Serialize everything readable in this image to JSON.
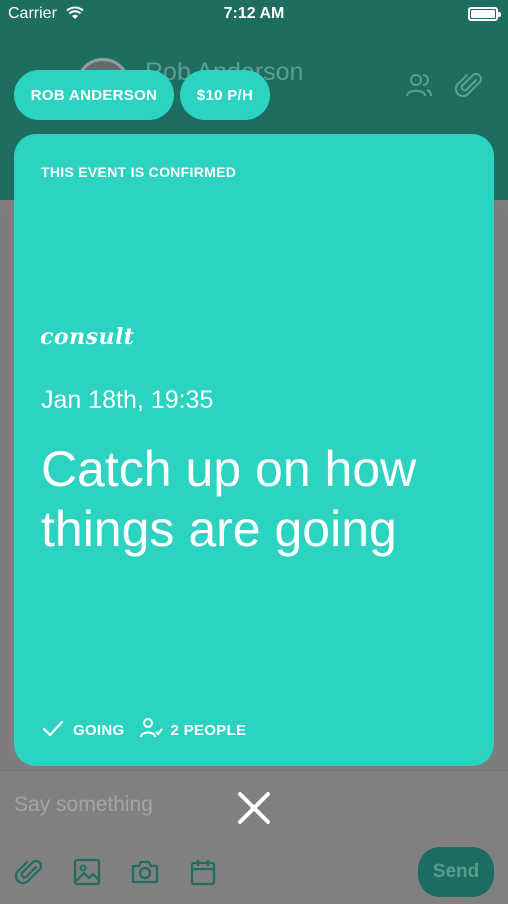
{
  "status_bar": {
    "carrier": "Carrier",
    "time": "7:12 AM"
  },
  "header": {
    "contact_name": "Rob Anderson"
  },
  "pills": {
    "name": "ROB ANDERSON",
    "rate": "$10 P/H"
  },
  "event": {
    "status": "THIS EVENT IS CONFIRMED",
    "logo": "consult",
    "date": "Jan 18th, 19:35",
    "title": "Catch up on how things are going",
    "going_label": "GOING",
    "people_label": "2 PEOPLE"
  },
  "composer": {
    "placeholder": "Say something",
    "send_label": "Send"
  },
  "colors": {
    "accent": "#2dd3c1",
    "header_dim": "#1d6d61",
    "overlay": "#7f7f7f"
  }
}
